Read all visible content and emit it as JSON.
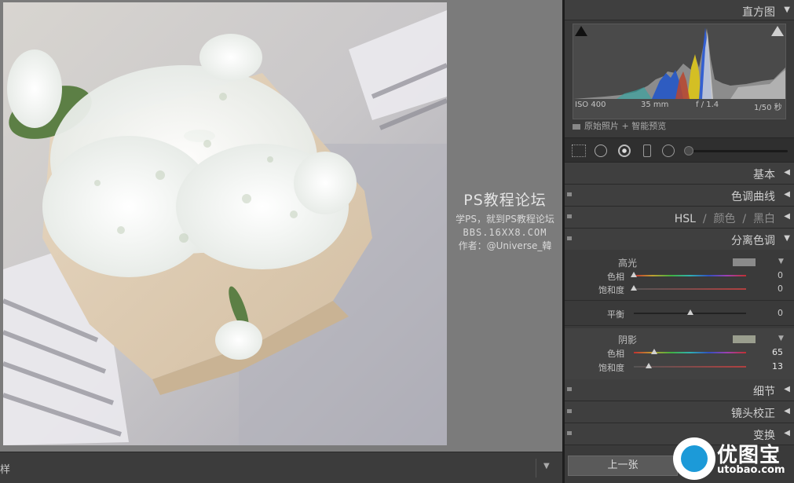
{
  "filmstrip": {
    "label": "样"
  },
  "watermark": {
    "title": "PS教程论坛",
    "line1": "学PS，就到PS教程论坛",
    "line2": "BBS.16XX8.COM",
    "line3": "作者：@Universe_韓"
  },
  "histogram": {
    "title": "直方图",
    "iso": "ISO 400",
    "focal": "35 mm",
    "aperture": "f / 1.4",
    "shutter": "1/50 秒",
    "preview_label": "原始照片 + 智能预览"
  },
  "panels": {
    "basic": "基本",
    "tone_curve": "色调曲线",
    "hsl_main": "HSL",
    "hsl_sep1": "/",
    "hsl_color": "颜色",
    "hsl_sep2": "/",
    "hsl_bw": "黑白",
    "split_toning": "分离色调",
    "detail": "细节",
    "lens": "镜头校正",
    "transform": "变换"
  },
  "split_toning": {
    "highlights": {
      "title": "高光",
      "swatch_color": "#8a8a8a",
      "hue_label": "色相",
      "hue_value": "0",
      "hue": 0,
      "sat_label": "饱和度",
      "sat_value": "0",
      "sat": 0
    },
    "balance": {
      "label": "平衡",
      "value": "0",
      "level": 0
    },
    "shadows": {
      "title": "阴影",
      "swatch_color": "#9a9e8e",
      "hue_label": "色相",
      "hue_value": "65",
      "hue": 65,
      "sat_label": "饱和度",
      "sat_value": "13",
      "sat": 13
    }
  },
  "buttons": {
    "prev": "上一张"
  },
  "logo": {
    "title": "优图宝",
    "url": "utobao.com"
  }
}
